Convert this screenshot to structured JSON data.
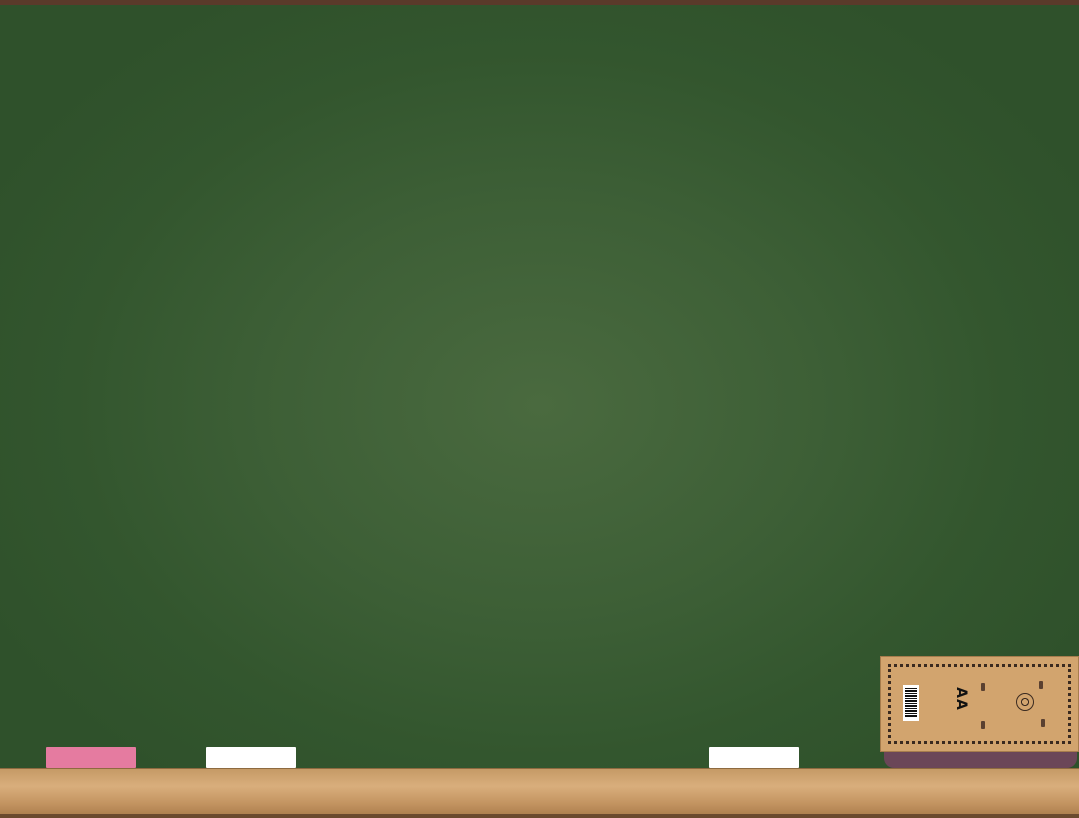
{
  "scene": {
    "board_color": "#3d5f36",
    "frame_color": "#5a3a2a",
    "tray_color": "#d2a46e"
  },
  "chalk": [
    {
      "name": "chalk-pink",
      "color": "#e57ba0"
    },
    {
      "name": "chalk-white",
      "color": "#ffffff"
    },
    {
      "name": "chalk-white",
      "color": "#ffffff"
    }
  ],
  "eraser": {
    "brand_text": "AA",
    "body_color": "#d2a46e",
    "felt_color": "#6b4658"
  }
}
